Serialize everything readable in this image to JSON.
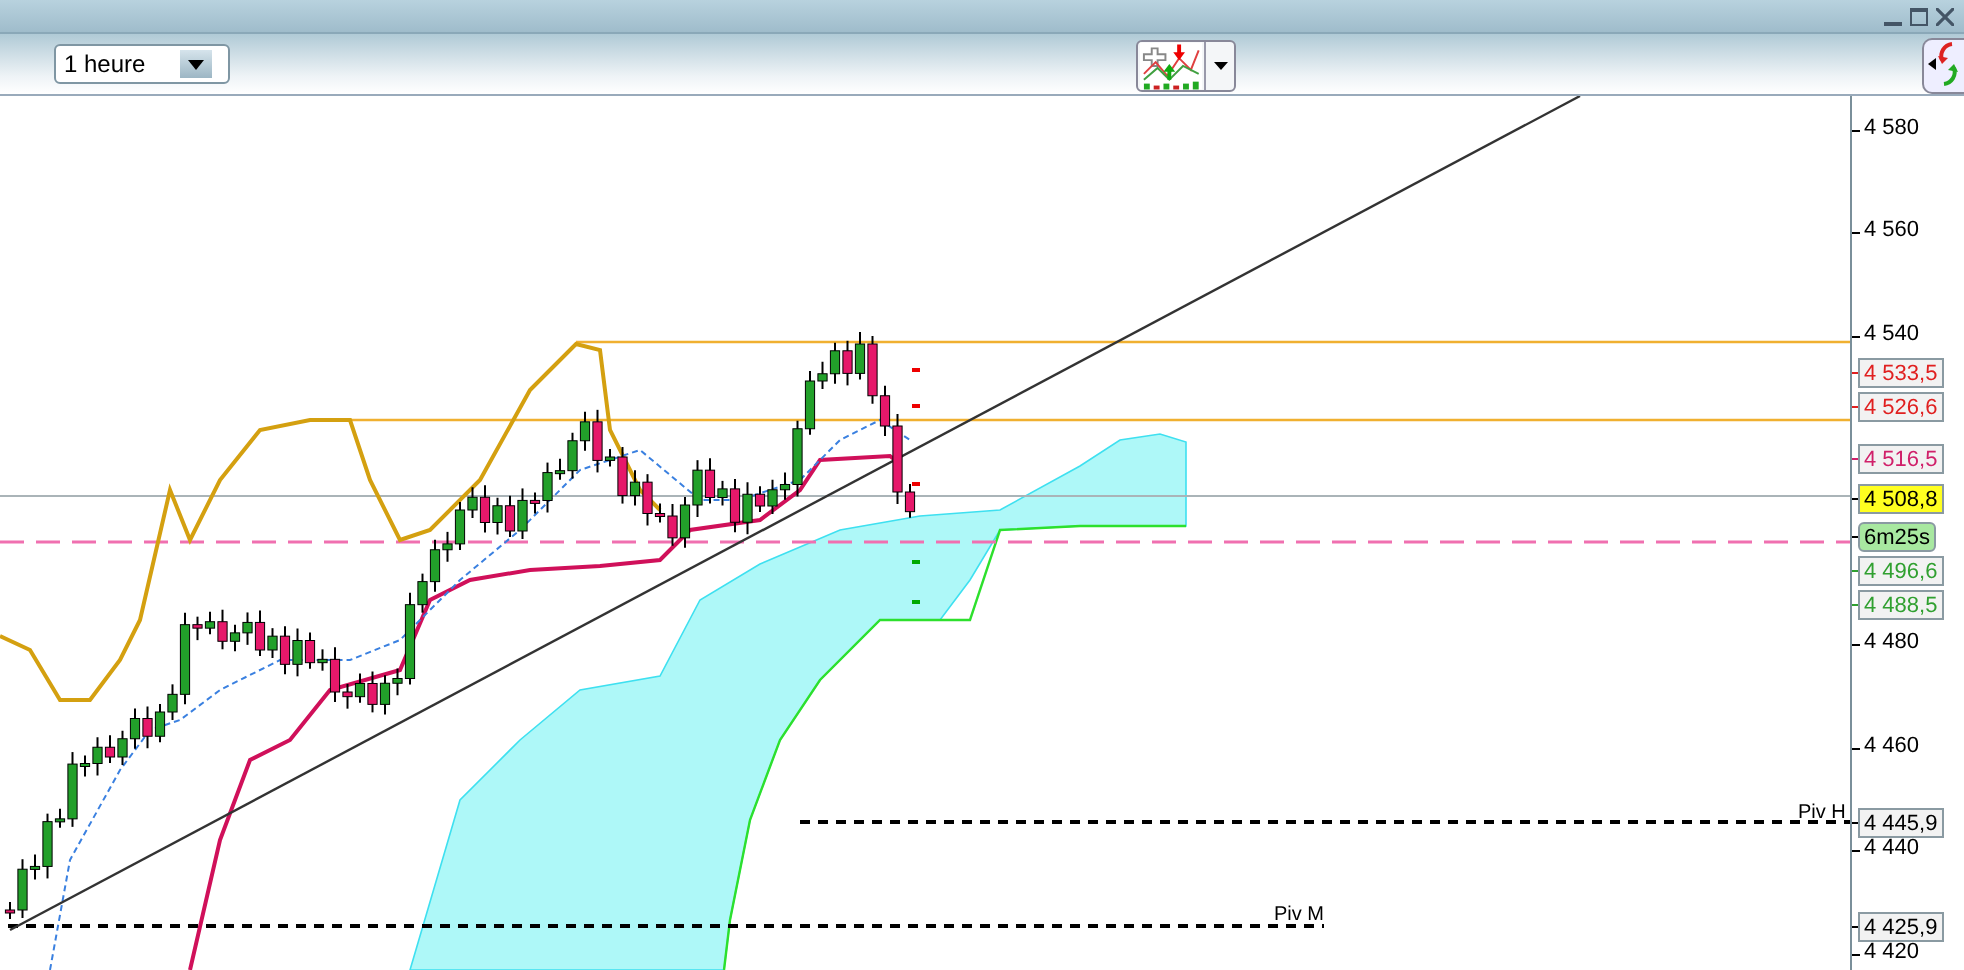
{
  "toolbar": {
    "timeframe": "1 heure"
  },
  "chart": {
    "axis_ticks": [
      "4 580",
      "4 560",
      "4 540",
      "4 480",
      "4 460",
      "4 440",
      "4 420"
    ],
    "price_tags": [
      {
        "text": "4 533,5",
        "kind": "plain",
        "color": "#e02020"
      },
      {
        "text": "4 526,6",
        "kind": "plain",
        "color": "#e02020"
      },
      {
        "text": "4 516,5",
        "kind": "plain",
        "color": "#d0206a"
      },
      {
        "text": "4 508,8",
        "kind": "current"
      },
      {
        "text": "6m25s",
        "kind": "timer"
      },
      {
        "text": "4 496,6",
        "kind": "plain",
        "color": "#30a030"
      },
      {
        "text": "4 488,5",
        "kind": "plain",
        "color": "#30a030"
      },
      {
        "text": "4 445,9",
        "kind": "plain",
        "color": "#000000"
      },
      {
        "text": "4 425,9",
        "kind": "plain",
        "color": "#000000"
      }
    ],
    "pivots": [
      {
        "label": "Piv H"
      },
      {
        "label": "Piv M"
      }
    ]
  }
}
